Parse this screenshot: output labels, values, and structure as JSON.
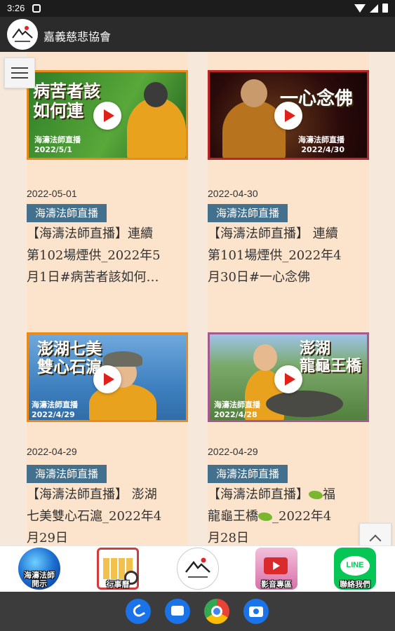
{
  "status_bar": {
    "time": "3:26"
  },
  "app_bar": {
    "title": "嘉義慈悲協會"
  },
  "cards": [
    {
      "thumb_title_line1": "病苦者該",
      "thumb_title_line2": "如何連",
      "thumb_tag": "海濤法師直播",
      "thumb_date": "2022/5/1",
      "date": "2022-05-01",
      "badge": "海濤法師直播",
      "title_lines": [
        "【海濤法師直播】連續",
        "第102場煙供_2022年5",
        "月1日#病苦者該如何…"
      ]
    },
    {
      "thumb_title_line1": "一心念佛",
      "thumb_tag": "海濤法師直播",
      "thumb_date": "2022/4/30",
      "date": "2022-04-30",
      "badge": "海濤法師直播",
      "title_lines": [
        "【海濤法師直播】 連續",
        "第101場煙供_2022年4",
        "月30日#一心念佛"
      ]
    },
    {
      "thumb_title_line1": "澎湖七美",
      "thumb_title_line2": "雙心石滬",
      "thumb_tag": "海濤法師直播",
      "thumb_date": "2022/4/29",
      "date": "2022-04-29",
      "badge": "海濤法師直播",
      "title_lines": [
        "【海濤法師直播】 澎湖",
        "七美雙心石滬_2022年4",
        "月29日"
      ]
    },
    {
      "thumb_title_line1": "澎湖",
      "thumb_title_line2": "龍龜王橋",
      "thumb_tag": "海濤法師直播",
      "thumb_date": "2022/4/28",
      "date": "2022-04-29",
      "badge": "海濤法師直播",
      "title_line1_prefix": "【海濤法師直播】",
      "title_line1_suffix": "福",
      "title_line2_prefix": "龍龜王橋",
      "title_line2_suffix": "_2022年4",
      "title_line3": "月28日"
    }
  ],
  "bottom_nav": [
    {
      "label": "海濤法師\n開示",
      "icon": "wave-icon"
    },
    {
      "label": "行事曆",
      "icon": "calendar-icon"
    },
    {
      "label": "",
      "icon": "logo-icon"
    },
    {
      "label": "影音專區",
      "icon": "video-icon"
    },
    {
      "label": "聯絡我們",
      "icon": "line-icon",
      "line_text": "LINE"
    }
  ],
  "colors": {
    "badge": "#43708c",
    "app_bar": "#2b2b2b",
    "background": "#f6e8da",
    "line_green": "#06c755"
  }
}
